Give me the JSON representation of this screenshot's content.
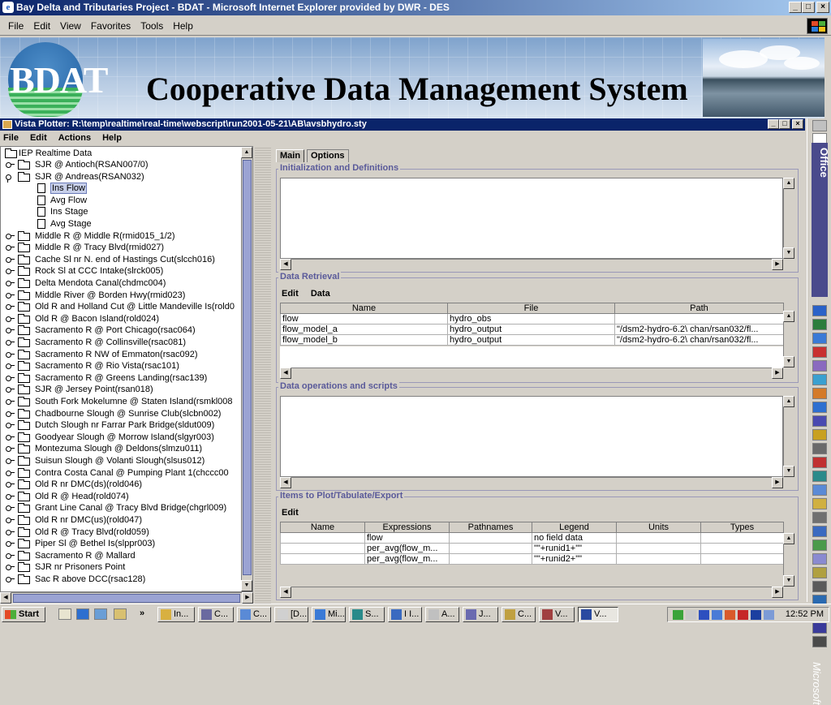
{
  "ie": {
    "title": "Bay Delta and Tributaries Project - BDAT - Microsoft Internet Explorer provided by DWR - DES",
    "menu": [
      "File",
      "Edit",
      "View",
      "Favorites",
      "Tools",
      "Help"
    ],
    "window_buttons": [
      "_",
      "□",
      "×"
    ]
  },
  "banner": {
    "logo_text": "BDAT",
    "title": "Cooperative Data Management System"
  },
  "vista": {
    "title": "Vista Plotter: R:\\temp\\realtime\\real-time\\webscript\\run2001-05-21\\AB\\avsbhydro.sty",
    "menu": [
      "File",
      "Edit",
      "Actions",
      "Help"
    ],
    "tree": {
      "root": "IEP Realtime Data",
      "selected": "Ins Flow",
      "items": [
        {
          "label": "SJR @ Antioch(RSAN007/0)",
          "level": 1,
          "open": false
        },
        {
          "label": "SJR @ Andreas(RSAN032)",
          "level": 1,
          "open": true
        },
        {
          "label": "Ins Flow",
          "level": 2
        },
        {
          "label": "Avg Flow",
          "level": 2
        },
        {
          "label": "Ins Stage",
          "level": 2
        },
        {
          "label": "Avg Stage",
          "level": 2
        },
        {
          "label": "Middle R @ Middle R(rmid015_1/2)",
          "level": 1
        },
        {
          "label": "Middle R @ Tracy Blvd(rmid027)",
          "level": 1
        },
        {
          "label": "Cache Sl nr N. end of Hastings Cut(slcch016)",
          "level": 1
        },
        {
          "label": "Rock Sl at CCC Intake(slrck005)",
          "level": 1
        },
        {
          "label": "Delta Mendota Canal(chdmc004)",
          "level": 1
        },
        {
          "label": "Middle River @ Borden Hwy(rmid023)",
          "level": 1
        },
        {
          "label": "Old R and Holland Cut @ Little Mandeville Is(rold0",
          "level": 1
        },
        {
          "label": "Old R @ Bacon Island(rold024)",
          "level": 1
        },
        {
          "label": "Sacramento R @ Port Chicago(rsac064)",
          "level": 1
        },
        {
          "label": "Sacramento R @ Collinsville(rsac081)",
          "level": 1
        },
        {
          "label": "Sacramento R NW of Emmaton(rsac092)",
          "level": 1
        },
        {
          "label": "Sacramento R @ Rio Vista(rsac101)",
          "level": 1
        },
        {
          "label": "Sacramento R @ Greens Landing(rsac139)",
          "level": 1
        },
        {
          "label": "SJR @ Jersey Point(rsan018)",
          "level": 1
        },
        {
          "label": "South Fork Mokelumne @ Staten Island(rsmkl008",
          "level": 1
        },
        {
          "label": "Chadbourne Slough @ Sunrise Club(slcbn002)",
          "level": 1
        },
        {
          "label": "Dutch Slough nr Farrar Park Bridge(sldut009)",
          "level": 1
        },
        {
          "label": "Goodyear Slough @ Morrow Island(slgyr003)",
          "level": 1
        },
        {
          "label": "Montezuma Slough @ Deldons(slmzu011)",
          "level": 1
        },
        {
          "label": "Suisun Slough @ Volanti Slough(slsus012)",
          "level": 1
        },
        {
          "label": "Contra Costa Canal @ Pumping Plant 1(chccc00",
          "level": 1
        },
        {
          "label": "Old R nr DMC(ds)(rold046)",
          "level": 1
        },
        {
          "label": "Old R @ Head(rold074)",
          "level": 1
        },
        {
          "label": "Grant Line Canal @ Tracy Blvd Bridge(chgrl009)",
          "level": 1
        },
        {
          "label": "Old R nr DMC(us)(rold047)",
          "level": 1
        },
        {
          "label": "Old R @ Tracy Blvd(rold059)",
          "level": 1
        },
        {
          "label": "Piper Sl @ Bethel Is(slppr003)",
          "level": 1
        },
        {
          "label": "Sacramento R @ Mallard",
          "level": 1
        },
        {
          "label": "SJR nr Prisoners Point",
          "level": 1
        },
        {
          "label": "Sac R above DCC(rsac128)",
          "level": 1
        }
      ]
    },
    "tabs": [
      "Main",
      "Options"
    ],
    "groups": {
      "init": "Initialization and Definitions",
      "retrieval": "Data Retrieval",
      "operations": "Data operations and scripts",
      "items": "Items to Plot/Tabulate/Export"
    },
    "retrieval": {
      "toolbar": [
        "Edit",
        "Data"
      ],
      "columns": [
        "Name",
        "File",
        "Path"
      ],
      "rows": [
        [
          "flow",
          "hydro_obs",
          ""
        ],
        [
          "flow_model_a",
          "hydro_output",
          "\"/dsm2-hydro-6.2\\ chan/rsan032/fl..."
        ],
        [
          "flow_model_b",
          "hydro_output",
          "\"/dsm2-hydro-6.2\\ chan/rsan032/fl..."
        ]
      ]
    },
    "items": {
      "toolbar": [
        "Edit"
      ],
      "columns": [
        "Name",
        "Expressions",
        "Pathnames",
        "Legend",
        "Units",
        "Types"
      ],
      "rows": [
        [
          "",
          "flow",
          "",
          "no field data",
          "",
          ""
        ],
        [
          "",
          "per_avg(flow_m...",
          "",
          "\"\"+runid1+\"\"",
          "",
          ""
        ],
        [
          "",
          "per_avg(flow_m...",
          "",
          "\"\"+runid2+\"\"",
          "",
          ""
        ]
      ]
    }
  },
  "office_bar": {
    "label": "Office",
    "brand": "Microsoft"
  },
  "taskbar": {
    "start": "Start",
    "chevron": "»",
    "buttons": [
      "In...",
      "C...",
      "C...",
      "[D...",
      "Mi...",
      "S...",
      "I I...",
      "A...",
      "J...",
      "C...",
      "V...",
      "V..."
    ],
    "active_index": 11,
    "clock": "12:52 PM"
  },
  "colors": {
    "title_bar": "#0a246a",
    "selection": "#c8d0ea",
    "group_title": "#5a5a9a",
    "scroll_thumb": "#9ba3d3"
  }
}
